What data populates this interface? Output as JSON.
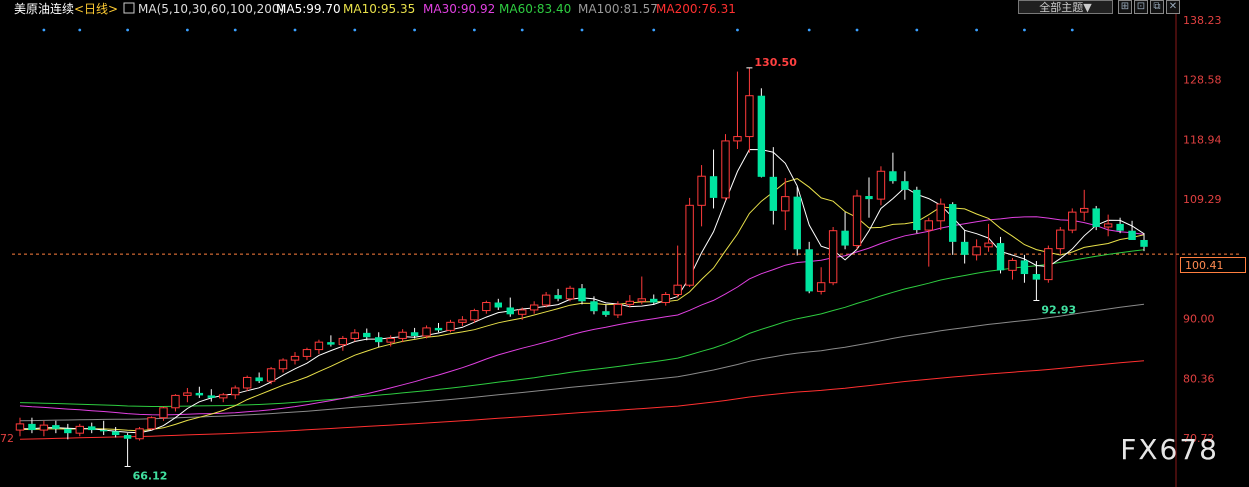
{
  "header": {
    "title": "美原油连续",
    "period": "<日线>",
    "ma_params": "MA(5,10,30,60,100,200)",
    "ma5": "MA5:99.70",
    "ma10": "MA10:95.35",
    "ma30": "MA30:90.92",
    "ma60": "MA60:83.40",
    "ma100": "MA100:81.57",
    "ma200": "MA200:76.31"
  },
  "toolbar": {
    "theme_label": "全部主题▼",
    "buttons": [
      "⊞",
      "⊡",
      "⧉",
      "✕"
    ]
  },
  "watermark": "FX678",
  "current_price": "100.41",
  "colors": {
    "up": "#ff3b3b",
    "down": "#00e5a0",
    "ma5": "#ffffff",
    "ma10": "#e8e04a",
    "ma30": "#e040e0",
    "ma60": "#2ecc40",
    "ma100": "#8a8a8a",
    "ma200": "#ff3030",
    "axis_text": "#e04040"
  },
  "chart_data": {
    "type": "candlestick",
    "y_ticks": [
      "138.23",
      "128.58",
      "118.94",
      "109.29",
      "90.00",
      "80.36",
      "70.72"
    ],
    "left_tick_partial": "72",
    "ylim": [
      70.72,
      138.23
    ],
    "annotations": [
      {
        "label": "130.50",
        "value": 130.5
      },
      {
        "label": "92.93",
        "value": 92.93
      },
      {
        "label": "66.12",
        "value": 66.12
      }
    ],
    "current_price_line": 100.41,
    "candles": [
      [
        72,
        74,
        71,
        73
      ],
      [
        73,
        74,
        71.5,
        72
      ],
      [
        72,
        73.5,
        71,
        72.8
      ],
      [
        72.8,
        73.5,
        71.5,
        72.2
      ],
      [
        72.2,
        73,
        70.5,
        71.5
      ],
      [
        71.5,
        73,
        71,
        72.6
      ],
      [
        72.6,
        73.2,
        71.5,
        72
      ],
      [
        72,
        73.5,
        71.2,
        71.8
      ],
      [
        71.8,
        72.5,
        70.8,
        71.2
      ],
      [
        71.2,
        71.5,
        66.12,
        70.6
      ],
      [
        70.6,
        72.5,
        70.3,
        72.2
      ],
      [
        72.2,
        74.2,
        72,
        74
      ],
      [
        74,
        75.8,
        73.5,
        75.6
      ],
      [
        75.6,
        77.8,
        75,
        77.6
      ],
      [
        77.6,
        78.8,
        76.5,
        78
      ],
      [
        78,
        79,
        77.2,
        77.6
      ],
      [
        77.6,
        78.6,
        76.6,
        77.2
      ],
      [
        77.2,
        78,
        76.5,
        77.7
      ],
      [
        77.7,
        79.2,
        77,
        78.8
      ],
      [
        78.8,
        80.8,
        78.3,
        80.5
      ],
      [
        80.5,
        81.3,
        79.6,
        79.9
      ],
      [
        79.9,
        82.2,
        79.4,
        81.9
      ],
      [
        81.9,
        83.6,
        81.3,
        83.3
      ],
      [
        83.3,
        84.6,
        82.6,
        83.9
      ],
      [
        83.9,
        85.3,
        83.3,
        85
      ],
      [
        85,
        86.6,
        84.3,
        86.2
      ],
      [
        86.2,
        87.3,
        85.5,
        85.8
      ],
      [
        85.8,
        87.2,
        84.8,
        86.8
      ],
      [
        86.8,
        88.3,
        86.3,
        87.7
      ],
      [
        87.7,
        88.4,
        86.5,
        87
      ],
      [
        87,
        87.8,
        85.4,
        86.2
      ],
      [
        86.2,
        87.3,
        85.5,
        86.8
      ],
      [
        86.8,
        88.3,
        86.2,
        87.8
      ],
      [
        87.8,
        88.5,
        86.8,
        87.2
      ],
      [
        87.2,
        88.9,
        86.8,
        88.5
      ],
      [
        88.5,
        89.3,
        87.8,
        88.1
      ],
      [
        88.1,
        89.8,
        87.8,
        89.4
      ],
      [
        89.4,
        90.4,
        88.8,
        89.8
      ],
      [
        89.8,
        91.6,
        89.3,
        91.3
      ],
      [
        91.3,
        92.9,
        90.8,
        92.6
      ],
      [
        92.6,
        93.2,
        91.4,
        91.8
      ],
      [
        91.8,
        93.4,
        90.3,
        90.7
      ],
      [
        90.7,
        91.8,
        89.8,
        91.4
      ],
      [
        91.4,
        92.8,
        90.8,
        92.2
      ],
      [
        92.2,
        94.3,
        91.8,
        93.8
      ],
      [
        93.8,
        94.8,
        92.8,
        93.2
      ],
      [
        93.2,
        95.3,
        92.8,
        94.9
      ],
      [
        94.9,
        95.6,
        92.3,
        92.8
      ],
      [
        92.8,
        93.6,
        90.7,
        91.2
      ],
      [
        91.2,
        92.3,
        90.3,
        90.6
      ],
      [
        90.6,
        92.8,
        90.1,
        92.3
      ],
      [
        92.3,
        93.8,
        91.8,
        92.8
      ],
      [
        92.8,
        96.8,
        92.3,
        93.2
      ],
      [
        93.2,
        93.9,
        92.2,
        92.6
      ],
      [
        92.6,
        94.3,
        92.1,
        93.9
      ],
      [
        93.9,
        101.8,
        93.4,
        95.4
      ],
      [
        95.4,
        109.5,
        95.1,
        108.3
      ],
      [
        108.3,
        114.8,
        104.9,
        113
      ],
      [
        113,
        117.3,
        107.8,
        109.5
      ],
      [
        109.5,
        119.8,
        109.1,
        118.7
      ],
      [
        118.7,
        129.9,
        117.4,
        119.4
      ],
      [
        119.4,
        130.5,
        116.8,
        126
      ],
      [
        126,
        127.2,
        112.8,
        112.9
      ],
      [
        112.9,
        117.7,
        105.2,
        107.4
      ],
      [
        107.4,
        112.7,
        104.3,
        109.7
      ],
      [
        109.7,
        111.3,
        100.2,
        101.2
      ],
      [
        101.2,
        102.4,
        94.1,
        94.4
      ],
      [
        94.4,
        98.3,
        93.9,
        95.8
      ],
      [
        95.8,
        104.8,
        95.4,
        104.2
      ],
      [
        104.2,
        107.2,
        101.2,
        101.8
      ],
      [
        101.8,
        110.8,
        101.2,
        109.8
      ],
      [
        109.8,
        112.8,
        106.3,
        109.3
      ],
      [
        109.3,
        114.6,
        108.3,
        113.8
      ],
      [
        113.8,
        116.8,
        111.8,
        112.2
      ],
      [
        112.2,
        113.8,
        109.2,
        110.8
      ],
      [
        110.8,
        111.3,
        103.8,
        104.3
      ],
      [
        104.3,
        106.3,
        98.4,
        105.8
      ],
      [
        105.8,
        109.4,
        104.3,
        108.5
      ],
      [
        108.5,
        108.8,
        100.3,
        102.4
      ],
      [
        102.4,
        104.3,
        98.9,
        100.3
      ],
      [
        100.3,
        102.8,
        99.4,
        101.6
      ],
      [
        101.6,
        105.3,
        100.8,
        102.2
      ],
      [
        102.2,
        103.2,
        97.3,
        97.8
      ],
      [
        97.8,
        99.8,
        96.3,
        99.4
      ],
      [
        99.4,
        100.3,
        95.8,
        97.2
      ],
      [
        97.2,
        99.3,
        92.93,
        96.3
      ],
      [
        96.3,
        101.8,
        95.8,
        101.3
      ],
      [
        101.3,
        104.8,
        100.3,
        104.3
      ],
      [
        104.3,
        107.8,
        103.8,
        107.2
      ],
      [
        107.2,
        110.8,
        105.8,
        107.8
      ],
      [
        107.8,
        108.2,
        104.3,
        104.8
      ],
      [
        104.8,
        106.8,
        103.3,
        105.3
      ],
      [
        105.3,
        106.3,
        103.8,
        104.2
      ],
      [
        104.2,
        105.8,
        102.8,
        102.7
      ],
      [
        102.7,
        103.8,
        100.9,
        101.6
      ]
    ]
  }
}
